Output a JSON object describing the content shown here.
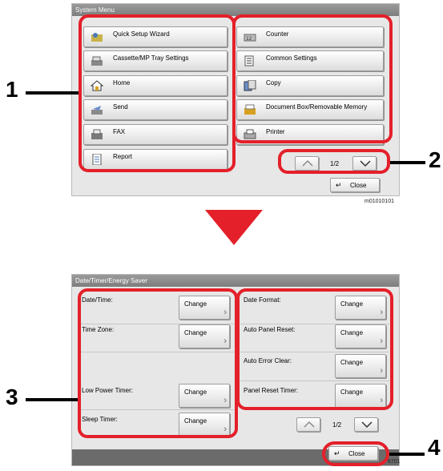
{
  "top_panel": {
    "title": "System Menu",
    "left_items": [
      {
        "label": "Quick Setup Wizard",
        "icon": "wizard-icon"
      },
      {
        "label": "Cassette/MP Tray Settings",
        "icon": "tray-icon"
      },
      {
        "label": "Home",
        "icon": "home-icon"
      },
      {
        "label": "Send",
        "icon": "send-icon"
      },
      {
        "label": "FAX",
        "icon": "fax-icon"
      },
      {
        "label": "Report",
        "icon": "report-icon"
      }
    ],
    "right_items": [
      {
        "label": "Counter",
        "icon": "counter-icon"
      },
      {
        "label": "Common Settings",
        "icon": "common-settings-icon"
      },
      {
        "label": "Copy",
        "icon": "copy-icon"
      },
      {
        "label": "Document Box/Removable Memory",
        "icon": "document-box-icon"
      },
      {
        "label": "Printer",
        "icon": "printer-icon"
      }
    ],
    "page_indicator": "1/2",
    "close_label": "Close",
    "figure_id": "m01010101"
  },
  "bottom_panel": {
    "title": "Date/Timer/Energy Saver",
    "left_rows": [
      {
        "label": "Date/Time:",
        "button": "Change"
      },
      {
        "label": "Time Zone:",
        "button": "Change"
      },
      {
        "label": "Low Power Timer:",
        "button": "Change"
      },
      {
        "label": "Sleep Timer:",
        "button": "Change"
      }
    ],
    "right_rows": [
      {
        "label": "Date Format:",
        "button": "Change"
      },
      {
        "label": "Auto Panel Reset:",
        "button": "Change"
      },
      {
        "label": "Auto Error Clear:",
        "button": "Change"
      },
      {
        "label": "Panel Reset Timer:",
        "button": "Change"
      }
    ],
    "page_indicator": "1/2",
    "close_label": "Close",
    "figure_id_partial": "6701"
  },
  "callouts": {
    "c1": "1",
    "c2": "2",
    "c3": "3",
    "c4": "4"
  },
  "colors": {
    "highlight": "#e4202a",
    "arrow": "#e4202a"
  }
}
